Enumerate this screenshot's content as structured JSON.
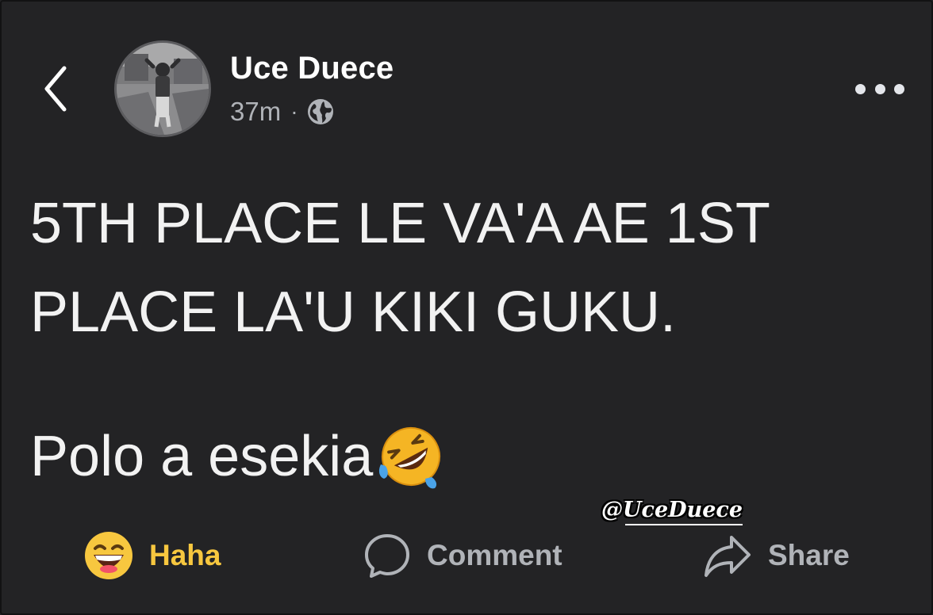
{
  "post": {
    "author": {
      "name": "Uce Duece"
    },
    "timestamp": "37m",
    "separator": "·",
    "audience_icon": "globe-icon",
    "text_lines": [
      "5TH PLACE LE VA'A AE 1ST",
      "PLACE LA'U KIKI GUKU."
    ],
    "text_second": "Polo a esekia",
    "text_emoji": "rolling-on-floor-laughing-emoji"
  },
  "header": {
    "back_icon": "chevron-left-icon",
    "more_icon": "more-horizontal-icon"
  },
  "watermark": "@UceDuece",
  "actions": {
    "reaction_label": "Haha",
    "reaction_icon": "haha-emoji",
    "comment_label": "Comment",
    "comment_icon": "comment-bubble-icon",
    "share_label": "Share",
    "share_icon": "share-arrow-icon"
  },
  "colors": {
    "background": "#232325",
    "text": "#f2f2f2",
    "secondary_text": "#b0b3b8",
    "haha_accent": "#f7c73f"
  }
}
